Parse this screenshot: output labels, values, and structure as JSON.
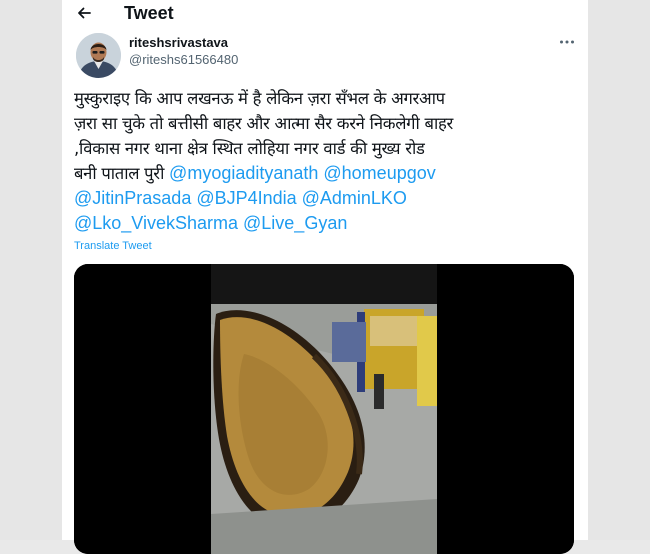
{
  "header": {
    "title": "Tweet"
  },
  "author": {
    "display_name": "riteshsrivastava",
    "handle": "@riteshs61566480"
  },
  "tweet": {
    "lines": [
      "मुस्कुराइए कि आप लखनऊ में है लेकिन ज़रा सँभल के अगरआप",
      "ज़रा सा चुके तो बत्तीसी बाहर और आत्मा सैर करने निकलेगी बाहर",
      ",विकास नगर थाना क्षेत्र स्थित लोहिया नगर वार्ड की मुख्य  रोड"
    ],
    "line4_text": "बनी पाताल पुरी ",
    "mentions": [
      "@myogiadityanath",
      "@homeupgov",
      "@JitinPrasada",
      "@BJP4India",
      "@AdminLKO",
      "@Lko_VivekSharma",
      "@Live_Gyan"
    ],
    "translate_label": "Translate Tweet"
  },
  "colors": {
    "link": "#1d9bf0",
    "text": "#0f1419",
    "muted": "#536471"
  },
  "icons": {
    "back": "arrow-left-icon",
    "more": "more-horizontal-icon"
  }
}
